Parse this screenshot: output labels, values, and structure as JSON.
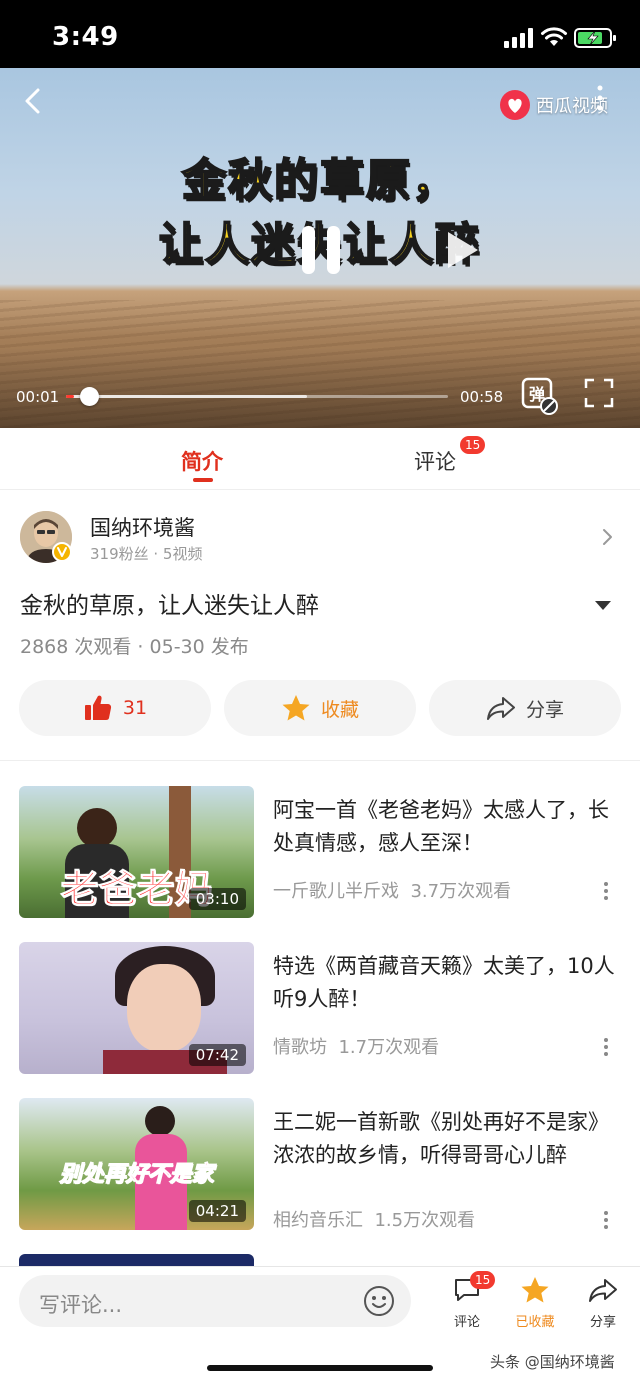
{
  "status_bar": {
    "time": "3:49"
  },
  "player": {
    "brand": "西瓜视频",
    "overlay_line1": "金秋的草原，",
    "overlay_line2": "让人迷失让人醉",
    "current_time": "00:01",
    "total_time": "00:58",
    "progress_fraction": 0.02,
    "buffered_fraction": 0.63,
    "danmaku_glyph": "弹"
  },
  "tabs": [
    {
      "label": "简介",
      "active": true
    },
    {
      "label": "评论",
      "badge": "15"
    }
  ],
  "author": {
    "name": "国纳环境酱",
    "stats": "319粉丝 · 5视频"
  },
  "video": {
    "title": "金秋的草原，让人迷失让人醉",
    "meta": "2868 次观看 · 05-30 发布"
  },
  "actions": {
    "like_count": "31",
    "favorite_label": "收藏",
    "share_label": "分享"
  },
  "related": [
    {
      "title": "阿宝一首《老爸老妈》太感人了，长处真情感，感人至深！",
      "author": "一斤歌儿半斤戏",
      "views": "3.7万次观看",
      "duration": "03:10",
      "thumb_text": "老爸老妈"
    },
    {
      "title": "特选《两首藏音天籁》太美了，10人听9人醉！",
      "author": "情歌坊",
      "views": "1.7万次观看",
      "duration": "07:42"
    },
    {
      "title": "王二妮一首新歌《别处再好不是家》浓浓的故乡情，听得哥哥心儿醉",
      "author": "相约音乐汇",
      "views": "1.5万次观看",
      "duration": "04:21",
      "thumb_text": "别处再好不是家"
    }
  ],
  "bottom_bar": {
    "comment_placeholder": "写评论...",
    "comment_label": "评论",
    "comment_badge": "15",
    "favorited_label": "已收藏",
    "share_label": "分享"
  },
  "watermark": "头条 @国纳环境酱",
  "colors": {
    "accent": "#e0301e",
    "favorite": "#ee8a1f",
    "badge": "#f23a2f",
    "overlay_text": "#f7d21e"
  }
}
